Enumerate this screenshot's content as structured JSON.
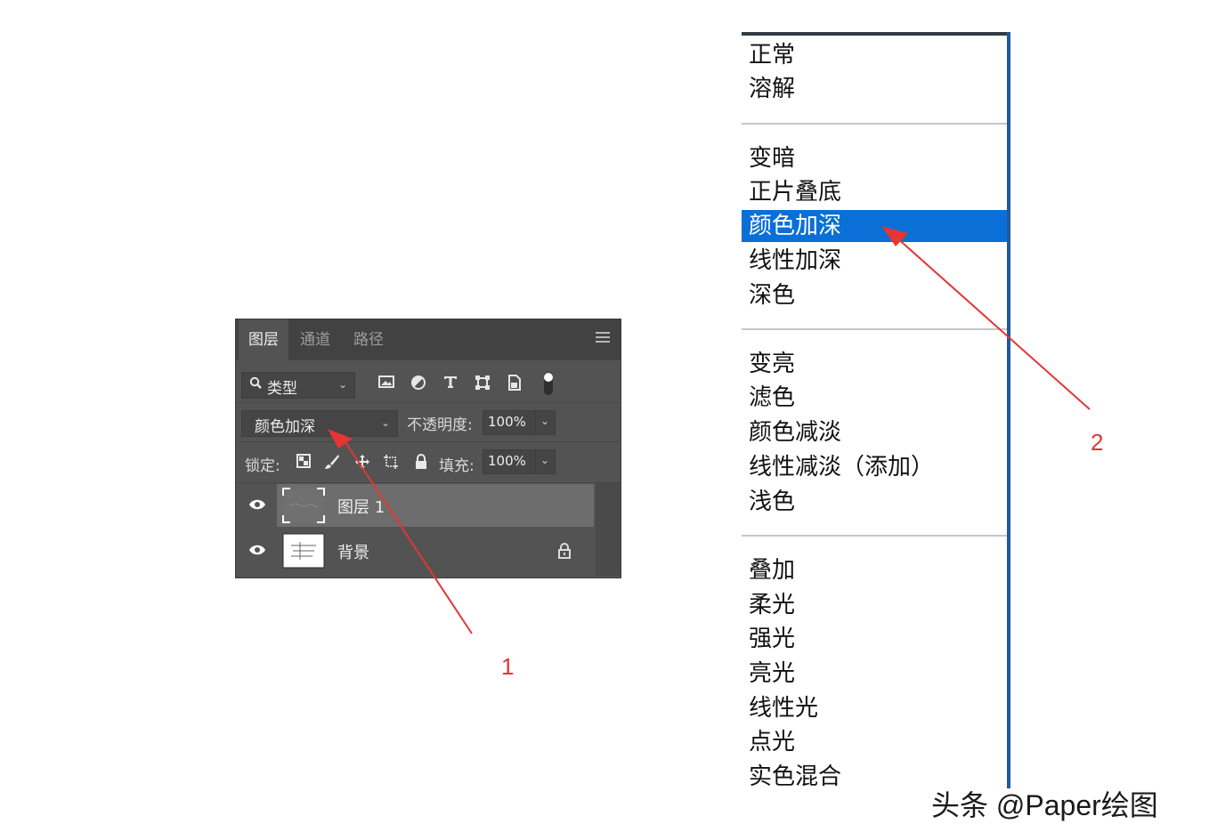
{
  "layers_panel": {
    "tabs": [
      "图层",
      "通道",
      "路径"
    ],
    "active_tab": 0,
    "filter": {
      "label": "类型"
    },
    "blend_mode": "颜色加深",
    "opacity_label": "不透明度:",
    "opacity_value": "100%",
    "lock_label": "锁定:",
    "fill_label": "填充:",
    "fill_value": "100%",
    "layers": [
      {
        "name": "图层 1",
        "selected": true
      },
      {
        "name": "背景",
        "selected": false,
        "locked": true
      }
    ]
  },
  "blend_menu": {
    "groups": [
      [
        "正常",
        "溶解"
      ],
      [
        "变暗",
        "正片叠底",
        "颜色加深",
        "线性加深",
        "深色"
      ],
      [
        "变亮",
        "滤色",
        "颜色减淡",
        "线性减淡（添加）",
        "浅色"
      ],
      [
        "叠加",
        "柔光",
        "强光",
        "亮光",
        "线性光",
        "点光",
        "实色混合"
      ]
    ],
    "selected": "颜色加深"
  },
  "annotations": {
    "arrow1_label": "1",
    "arrow2_label": "2",
    "color": "#e53535"
  },
  "colors": {
    "panel_bg": "#535353",
    "selected_layer": "#6d6d6d",
    "menu_highlight": "#0a6fd6"
  },
  "watermark": "头条 @Paper绘图"
}
